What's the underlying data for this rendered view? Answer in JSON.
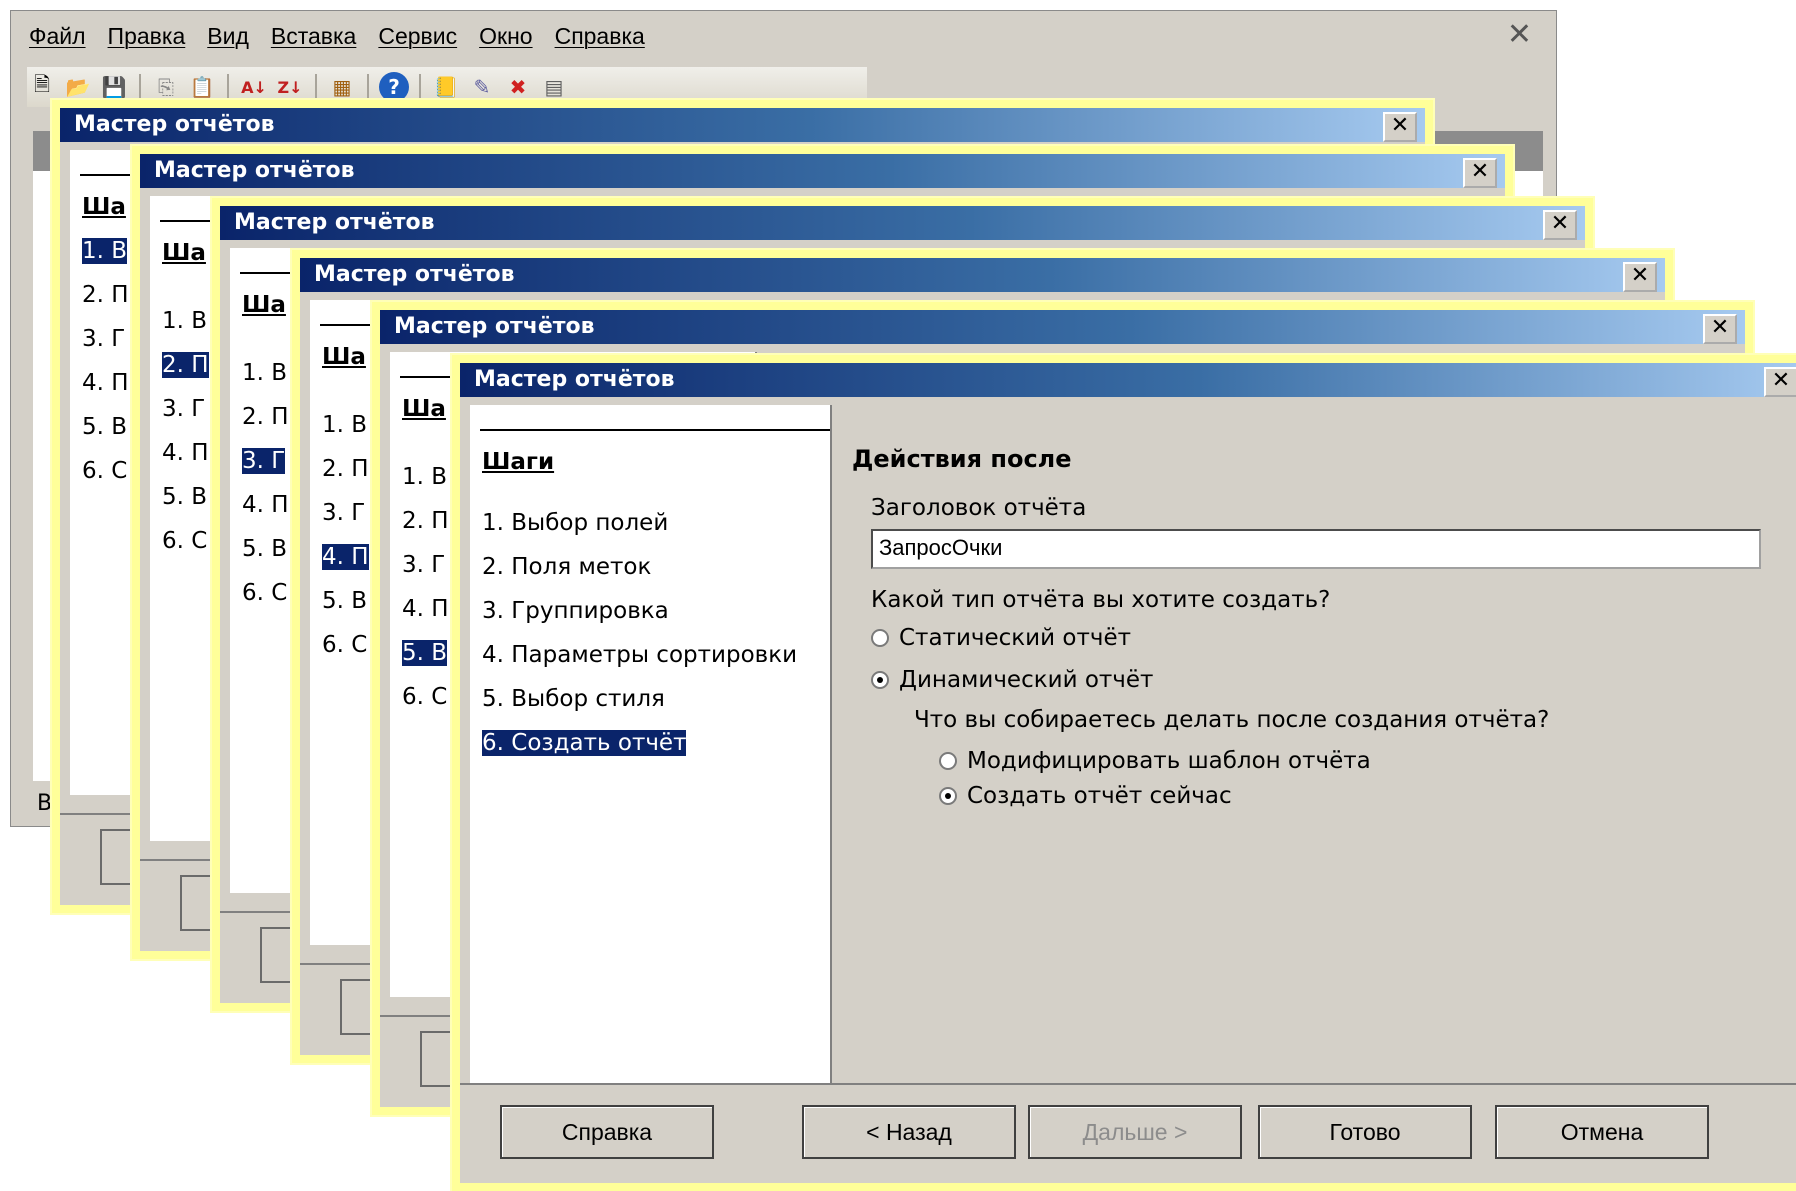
{
  "app": {
    "menu": [
      "Файл",
      "Правка",
      "Вид",
      "Вставка",
      "Сервис",
      "Окно",
      "Справка"
    ],
    "status_text": "В"
  },
  "dialog_title": "Мастер отчётов",
  "left_panel": {
    "heading": "Шаги",
    "heading_cropped": "Ша",
    "steps": [
      "1. Выбор полей",
      "2. Поля меток",
      "3. Группировка",
      "4. Параметры сортировки",
      "5. Выбор стиля",
      "6. Создать отчёт"
    ],
    "steps_cropped": [
      "1. В",
      "2. П",
      "3. Г",
      "4. П",
      "5. В",
      "6. С"
    ],
    "selected_index": 5
  },
  "right_panel": {
    "title": "Действия после",
    "report_title_label": "Заголовок отчёта",
    "report_title_value": "ЗапросОчки",
    "type_question": "Какой тип отчёта вы хотите создать?",
    "type_options": [
      {
        "label": "Статический отчёт",
        "selected": false
      },
      {
        "label": "Динамический отчёт",
        "selected": true
      }
    ],
    "after_question": "Что вы собираетесь делать после создания отчёта?",
    "after_options": [
      {
        "label": "Модифицировать шаблон отчёта",
        "selected": false
      },
      {
        "label": "Создать отчёт сейчас",
        "selected": true
      }
    ]
  },
  "buttons": {
    "help": "Справка",
    "back": "< Назад",
    "next": "Дальше >",
    "finish": "Готово",
    "cancel": "Отмена"
  },
  "colors": {
    "highlight": "#ffff99",
    "title_start": "#0a246a",
    "title_end": "#a6caf0",
    "selection": "#0a246a",
    "dialog_bg": "#d4d0c8"
  }
}
